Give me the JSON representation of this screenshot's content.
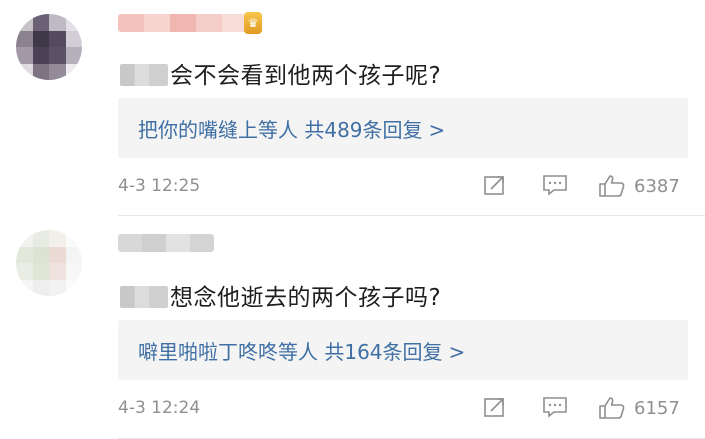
{
  "comments": [
    {
      "text_suffix": "会不会看到他两个孩子呢?",
      "reply_summary": "把你的嘴缝上等人 共489条回复",
      "reply_arrow": ">",
      "timestamp": "4-3 12:25",
      "like_count": "6387",
      "avatar_colors": [
        "#c7c4c9",
        "#6a6274",
        "#bfb9c4",
        "#e4e1e6",
        "#8b8290",
        "#3f3849",
        "#544b5e",
        "#d2ced6",
        "#a29aa8",
        "#4a4156",
        "#5b5064",
        "#b6b0bc",
        "#dedbe0",
        "#7c7483",
        "#938b99",
        "#eceaee"
      ],
      "username_colors": [
        "#f3c2bd",
        "#f7d4cf",
        "#f1b6b0",
        "#f5cec9",
        "#f8dcd8"
      ],
      "vip_icon": "vip-crown-icon"
    },
    {
      "text_suffix": "想念他逝去的两个孩子吗?",
      "reply_summary": "噼里啪啦丁咚咚等人 共164条回复",
      "reply_arrow": ">",
      "timestamp": "4-3 12:24",
      "like_count": "6157",
      "avatar_colors": [
        "#f1f1ef",
        "#e7ebe1",
        "#f3efe9",
        "#fafafa",
        "#e2e8d9",
        "#dde3d2",
        "#ecdad4",
        "#f4f4f4",
        "#e9ede3",
        "#e0e5d6",
        "#f0e2de",
        "#f7f7f7",
        "#f5f5f5",
        "#eeeeee",
        "#f2f2f2",
        "#fbfbfb"
      ],
      "username_colors": [
        "#d8d8d8",
        "#cfcfcf",
        "#e2e2e2",
        "#d4d4d4"
      ]
    }
  ],
  "icons": {
    "share": "share-icon",
    "comment": "comment-icon",
    "like": "thumbs-up-icon"
  },
  "colors": {
    "link": "#3f6fa4",
    "meta": "#8f8f8f",
    "reply_bg": "#f4f4f4"
  }
}
